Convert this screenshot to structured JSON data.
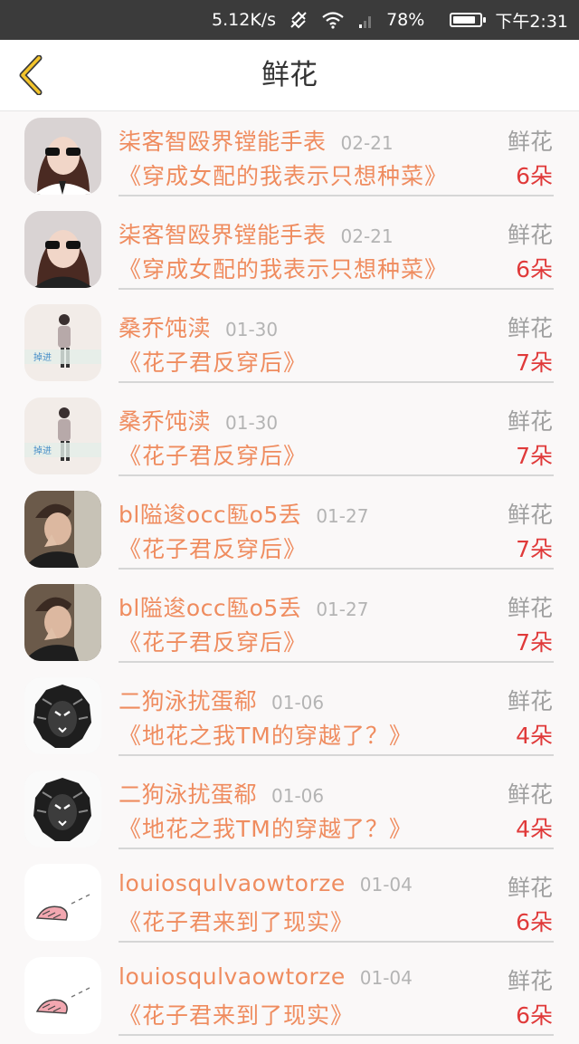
{
  "status_bar": {
    "speed": "5.12K/s",
    "battery": "78%",
    "time": "下午2:31"
  },
  "header": {
    "title": "鲜花"
  },
  "items": [
    {
      "name": "柒客智殴界镗能手表",
      "date": "02-21",
      "book": "《穿成女配的我表示只想种菜》",
      "label": "鲜花",
      "count": "6朵",
      "avatar": "girl-sunglasses"
    },
    {
      "name": "柒客智殴界镗能手表",
      "date": "02-21",
      "book": "《穿成女配的我表示只想种菜》",
      "label": "鲜花",
      "count": "6朵",
      "avatar": "girl-sunglasses"
    },
    {
      "name": "桑乔饨渎",
      "date": "01-30",
      "book": "《花子君反穿后》",
      "label": "鲜花",
      "count": "7朵",
      "avatar": "figure-caption",
      "avatar_text": "掉进"
    },
    {
      "name": "桑乔饨渎",
      "date": "01-30",
      "book": "《花子君反穿后》",
      "label": "鲜花",
      "count": "7朵",
      "avatar": "figure-caption",
      "avatar_text": "掉进"
    },
    {
      "name": "bl隘逡occ匦o5丢",
      "date": "01-27",
      "book": "《花子君反穿后》",
      "label": "鲜花",
      "count": "7朵",
      "avatar": "boy-photo"
    },
    {
      "name": "bl隘逡occ匦o5丢",
      "date": "01-27",
      "book": "《花子君反穿后》",
      "label": "鲜花",
      "count": "7朵",
      "avatar": "boy-photo"
    },
    {
      "name": "二狗泳扰蛋郗",
      "date": "01-06",
      "book": "《地花之我TM的穿越了？》",
      "label": "鲜花",
      "count": "4朵",
      "avatar": "lion"
    },
    {
      "name": "二狗泳扰蛋郗",
      "date": "01-06",
      "book": "《地花之我TM的穿越了？》",
      "label": "鲜花",
      "count": "4朵",
      "avatar": "lion"
    },
    {
      "name": "louiosqulvaowtorze",
      "date": "01-04",
      "book": "《花子君来到了现实》",
      "label": "鲜花",
      "count": "6朵",
      "avatar": "pink-cartoon"
    },
    {
      "name": "louiosqulvaowtorze",
      "date": "01-04",
      "book": "《花子君来到了现实》",
      "label": "鲜花",
      "count": "6朵",
      "avatar": "pink-cartoon"
    }
  ]
}
